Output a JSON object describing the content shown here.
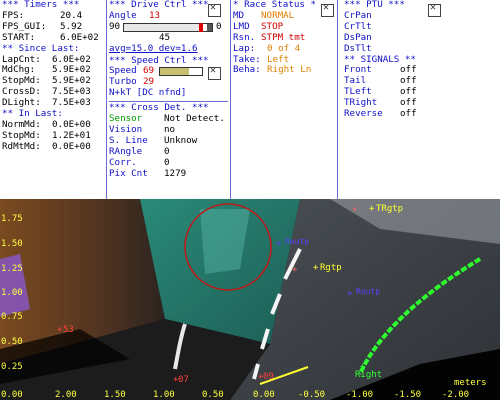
{
  "timers": {
    "header": "*** Timers ***",
    "rows": [
      {
        "label": "FPS:",
        "value": "20.4"
      },
      {
        "label": "FPS_GUI:",
        "value": "5.92"
      },
      {
        "label": "START:",
        "value": "6.0E+02"
      }
    ],
    "since_header": "** Since Last:",
    "since_rows": [
      {
        "label": "LapCnt:",
        "value": "6.0E+02"
      },
      {
        "label": "MdChg:",
        "value": "5.9E+02"
      },
      {
        "label": "StopMd:",
        "value": "5.9E+02"
      },
      {
        "label": "CrossD:",
        "value": "7.5E+03"
      },
      {
        "label": "DLight:",
        "value": "7.5E+03"
      }
    ],
    "inlast_header": "** In Last:",
    "inlast_rows": [
      {
        "label": "NormMd:",
        "value": "0.0E+00"
      },
      {
        "label": "StopMd:",
        "value": "1.2E+01"
      },
      {
        "label": "RdMtMd:",
        "value": "0.0E+00"
      }
    ]
  },
  "drive": {
    "header": "*** Drive Ctrl ***",
    "angle_label": "Angle",
    "angle_value": "13",
    "slider_min": "90",
    "slider_max": "0",
    "slider_level": 0.86,
    "slider_center": "45",
    "avg_text": "avg=15.0 dev=1.6",
    "speed_header": "*** Speed Ctrl ***",
    "speed_label": "Speed",
    "speed_value": "69",
    "speed_level": 0.69,
    "turbo_label": "Turbo",
    "turbo_value": "29",
    "nkt_text": "N+kT [DC nfnd]",
    "cross_header": "*** Cross Det. ***",
    "cross_rows": [
      {
        "label": "Sensor",
        "value": "Not Detect."
      },
      {
        "label": "Vision",
        "value": "no"
      },
      {
        "label": "S. Line",
        "value": "Unknow"
      },
      {
        "label": "RAngle",
        "value": "0"
      },
      {
        "label": "Corr.",
        "value": "0"
      },
      {
        "label": "Pix Cnt",
        "value": "1279"
      }
    ]
  },
  "race": {
    "header": "* Race Status *",
    "rows": [
      {
        "label": "MD",
        "value": "NORMAL",
        "color": "#e08000"
      },
      {
        "label": "LMD",
        "value": "STOP",
        "color": "#d00000"
      },
      {
        "label": "Rsn.",
        "value": "STPM tmt",
        "color": "#d00000"
      },
      {
        "label": "Lap:",
        "value": "0 of 4",
        "color": "#e08000"
      },
      {
        "label": "Take:",
        "value": "Left",
        "color": "#e08000"
      },
      {
        "label": "Beha:",
        "value": "Right Ln",
        "color": "#e08000"
      }
    ]
  },
  "ptu": {
    "header": "*** PTU ***",
    "items": [
      "CrPan",
      "CrTlt",
      "DsPan",
      "DsTlt"
    ],
    "signals_header": "** SIGNALS **",
    "signals": [
      {
        "label": "Front",
        "value": "off"
      },
      {
        "label": "Tail",
        "value": "off"
      },
      {
        "label": "TLeft",
        "value": "off"
      },
      {
        "label": "TRight",
        "value": "off"
      },
      {
        "label": "Reverse",
        "value": "off"
      }
    ]
  },
  "camera": {
    "y_ticks": [
      "1.75",
      "1.50",
      "1.25",
      "1.00",
      "0.75",
      "0.50",
      "0.25",
      "0.00"
    ],
    "x_ticks": [
      "2.00",
      "1.50",
      "1.00",
      "0.50",
      "0.00",
      "-0.50",
      "-1.00",
      "-1.50",
      "-2.00"
    ],
    "units": "meters",
    "labels": {
      "trgtp": "TRgtp",
      "rgtp": "Rgtp",
      "rtoutp1": "Routp",
      "rtoutp2": "Routp",
      "right": "Right",
      "n53": "53",
      "n07": "07",
      "n09": "09"
    },
    "colors": {
      "target_circle": "#c01818",
      "yellow": "#ffff30",
      "purple": "#6040ff",
      "red_mark": "#ff3030",
      "green": "#30ff30",
      "tick": "#ffff40"
    }
  }
}
